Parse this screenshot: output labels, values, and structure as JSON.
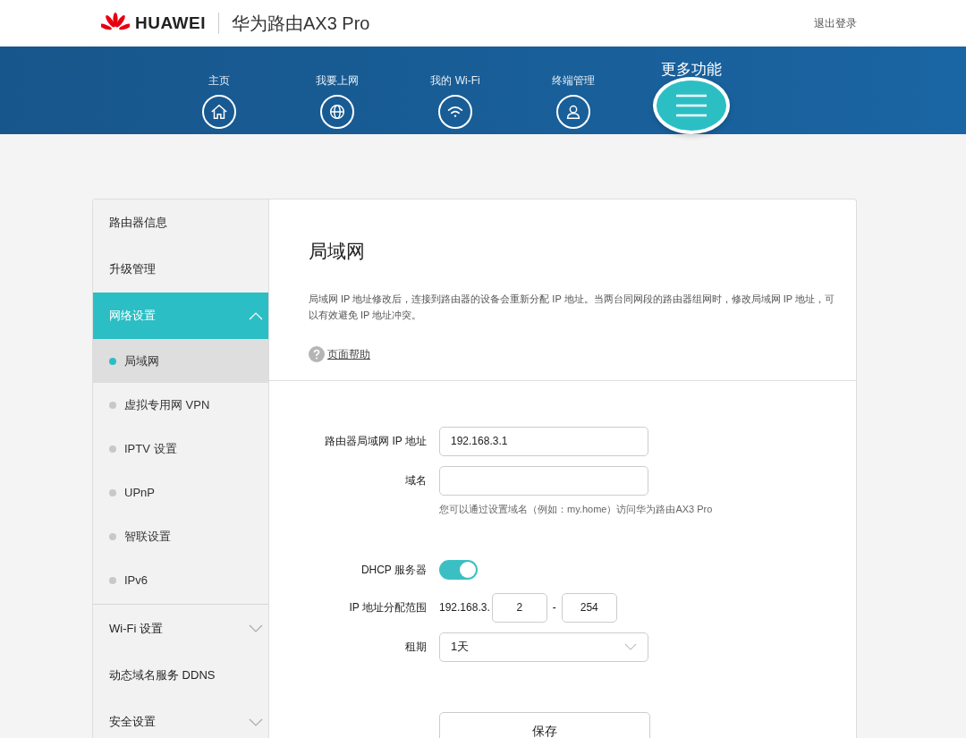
{
  "header": {
    "brand": "HUAWEI",
    "product": "华为路由AX3 Pro",
    "logout": "退出登录"
  },
  "nav": [
    {
      "label": "主页",
      "kind": "home",
      "selected": false
    },
    {
      "label": "我要上网",
      "kind": "globe",
      "selected": false
    },
    {
      "label": "我的 Wi-Fi",
      "kind": "wifi",
      "selected": false
    },
    {
      "label": "终端管理",
      "kind": "user",
      "selected": false
    },
    {
      "label": "更多功能",
      "kind": "menu",
      "selected": true
    }
  ],
  "sidebar": {
    "items": [
      {
        "label": "路由器信息",
        "kind": "link",
        "selected": false
      },
      {
        "label": "升级管理",
        "kind": "link",
        "selected": false
      },
      {
        "label": "网络设置",
        "kind": "folder",
        "expanded": true,
        "selected": true,
        "children": [
          {
            "label": "局域网",
            "selected": true
          },
          {
            "label": "虚拟专用网 VPN",
            "selected": false
          },
          {
            "label": "IPTV 设置",
            "selected": false
          },
          {
            "label": "UPnP",
            "selected": false
          },
          {
            "label": "智联设置",
            "selected": false
          },
          {
            "label": "IPv6",
            "selected": false
          }
        ]
      },
      {
        "label": "Wi-Fi 设置",
        "kind": "folder",
        "expanded": false,
        "selected": false
      },
      {
        "label": "动态域名服务 DDNS",
        "kind": "link",
        "selected": false
      },
      {
        "label": "安全设置",
        "kind": "folder",
        "expanded": false,
        "selected": false
      }
    ]
  },
  "content": {
    "title": "局域网",
    "description": "局域网 IP 地址修改后，连接到路由器的设备会重新分配 IP 地址。当两台同网段的路由器组网时，修改局域网 IP 地址，可以有效避免 IP 地址冲突。",
    "help": "页面帮助",
    "form": {
      "lan_ip": {
        "label": "路由器局域网 IP 地址",
        "value": "192.168.3.1"
      },
      "domain": {
        "label": "域名",
        "hint": "您可以通过设置域名（例如：my.home）访问华为路由AX3 Pro"
      },
      "dhcp": {
        "label": "DHCP 服务器",
        "on": true
      },
      "range": {
        "label": "IP 地址分配范围",
        "prefix": "192.168.3.",
        "start": "2",
        "separator": "-",
        "end": "254"
      },
      "lease": {
        "label": "租期",
        "value": "1天"
      },
      "save": "保存"
    }
  }
}
